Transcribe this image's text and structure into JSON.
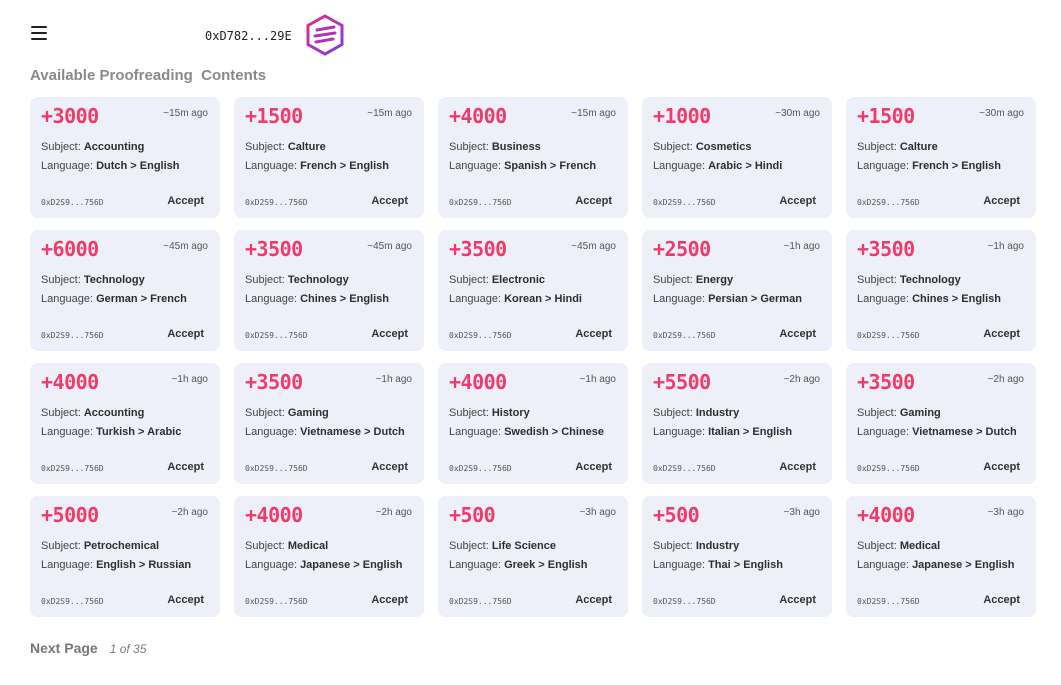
{
  "header": {
    "wallet_address": "0xD782...29E",
    "icons": {
      "menu": "hamburger-menu-icon",
      "logo": "hexagon-logo-icon"
    },
    "logo_colors": [
      "#e0307a",
      "#7a3cf0"
    ]
  },
  "section_title": "Available Proofreading  Contents",
  "labels": {
    "subject": "Subject: ",
    "language": "Language: ",
    "accept": "Accept"
  },
  "colors": {
    "amount": "#ef3b6a",
    "card_bg": "#eef0f9"
  },
  "cards": [
    {
      "amount": "+3000",
      "time": "~15m ago",
      "subject": "Accounting",
      "language": "Dutch > English",
      "address": "0xD2S9...756D"
    },
    {
      "amount": "+1500",
      "time": "~15m ago",
      "subject": "Calture",
      "language": "French > English",
      "address": "0xD2S9...756D"
    },
    {
      "amount": "+4000",
      "time": "~15m ago",
      "subject": "Business",
      "language": "Spanish > French",
      "address": "0xD2S9...756D"
    },
    {
      "amount": "+1000",
      "time": "~30m ago",
      "subject": "Cosmetics",
      "language": "Arabic > Hindi",
      "address": "0xD2S9...756D"
    },
    {
      "amount": "+1500",
      "time": "~30m ago",
      "subject": "Calture",
      "language": "French > English",
      "address": "0xD2S9...756D"
    },
    {
      "amount": "+6000",
      "time": "~45m ago",
      "subject": "Technology",
      "language": "German > French",
      "address": "0xD2S9...756D"
    },
    {
      "amount": "+3500",
      "time": "~45m ago",
      "subject": "Technology",
      "language": "Chines > English",
      "address": "0xD2S9...756D"
    },
    {
      "amount": "+3500",
      "time": "~45m ago",
      "subject": "Electronic",
      "language": "Korean > Hindi",
      "address": "0xD2S9...756D"
    },
    {
      "amount": "+2500",
      "time": "~1h ago",
      "subject": "Energy",
      "language": "Persian > German",
      "address": "0xD2S9...756D"
    },
    {
      "amount": "+3500",
      "time": "~1h ago",
      "subject": "Technology",
      "language": "Chines > English",
      "address": "0xD2S9...756D"
    },
    {
      "amount": "+4000",
      "time": "~1h ago",
      "subject": "Accounting",
      "language": "Turkish > Arabic",
      "address": "0xD2S9...756D"
    },
    {
      "amount": "+3500",
      "time": "~1h ago",
      "subject": "Gaming",
      "language": "Vietnamese > Dutch",
      "address": "0xD2S9...756D"
    },
    {
      "amount": "+4000",
      "time": "~1h ago",
      "subject": "History",
      "language": "Swedish > Chinese",
      "address": "0xD2S9...756D"
    },
    {
      "amount": "+5500",
      "time": "~2h ago",
      "subject": "Industry",
      "language": "Italian > English",
      "address": "0xD2S9...756D"
    },
    {
      "amount": "+3500",
      "time": "~2h ago",
      "subject": "Gaming",
      "language": "Vietnamese > Dutch",
      "address": "0xD2S9...756D"
    },
    {
      "amount": "+5000",
      "time": "~2h ago",
      "subject": "Petrochemical",
      "language": "English > Russian",
      "address": "0xD2S9...756D"
    },
    {
      "amount": "+4000",
      "time": "~2h ago",
      "subject": "Medical",
      "language": "Japanese > English",
      "address": "0xD2S9...756D"
    },
    {
      "amount": "+500",
      "time": "~3h ago",
      "subject": "Life Science",
      "language": "Greek > English",
      "address": "0xD2S9...756D"
    },
    {
      "amount": "+500",
      "time": "~3h ago",
      "subject": "Industry",
      "language": "Thai > English",
      "address": "0xD2S9...756D"
    },
    {
      "amount": "+4000",
      "time": "~3h ago",
      "subject": "Medical",
      "language": "Japanese > English",
      "address": "0xD2S9...756D"
    }
  ],
  "pagination": {
    "next_label": "Next Page",
    "page_info": "1 of 35"
  }
}
